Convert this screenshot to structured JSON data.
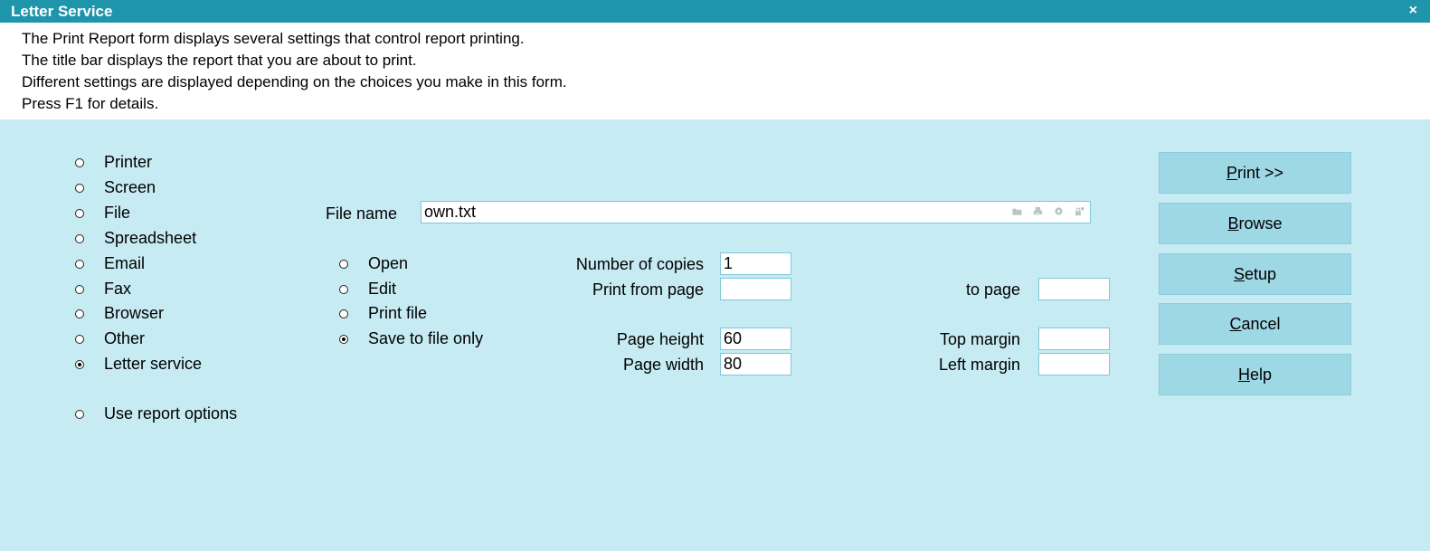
{
  "window": {
    "title": "Letter Service",
    "close_label": "×"
  },
  "info_lines": [
    "The Print Report form displays several settings that control report printing.",
    "The title bar displays the report that you are about to print.",
    "Different settings are displayed depending on the choices you make in this form.",
    "Press F1 for details."
  ],
  "destinations": [
    {
      "label": "Printer",
      "checked": false
    },
    {
      "label": "Screen",
      "checked": false
    },
    {
      "label": "File",
      "checked": false
    },
    {
      "label": "Spreadsheet",
      "checked": false
    },
    {
      "label": "Email",
      "checked": false
    },
    {
      "label": "Fax",
      "checked": false
    },
    {
      "label": "Browser",
      "checked": false
    },
    {
      "label": "Other",
      "checked": false
    },
    {
      "label": "Letter service",
      "checked": true
    }
  ],
  "use_report_options": {
    "label": "Use report options",
    "checked": false
  },
  "file_name": {
    "label": "File name",
    "value": "own.txt"
  },
  "file_actions": [
    {
      "label": "Open",
      "checked": false
    },
    {
      "label": "Edit",
      "checked": false
    },
    {
      "label": "Print file",
      "checked": false
    },
    {
      "label": "Save to file only",
      "checked": true
    }
  ],
  "settings": {
    "copies": {
      "label": "Number of copies",
      "value": "1"
    },
    "from_page": {
      "label": "Print from page",
      "value": ""
    },
    "to_page": {
      "label": "to page",
      "value": ""
    },
    "page_height": {
      "label": "Page height",
      "value": "60"
    },
    "top_margin": {
      "label": "Top margin",
      "value": ""
    },
    "page_width": {
      "label": "Page width",
      "value": "80"
    },
    "left_margin": {
      "label": "Left margin",
      "value": ""
    }
  },
  "buttons": {
    "print": {
      "accel": "P",
      "rest": "rint >>"
    },
    "browse": {
      "accel": "B",
      "rest": "rowse"
    },
    "setup": {
      "accel": "S",
      "rest": "etup"
    },
    "cancel": {
      "accel": "C",
      "rest": "ancel"
    },
    "help": {
      "accel": "H",
      "rest": "elp"
    }
  },
  "colors": {
    "titlebar": "#1f95ab",
    "background": "#c7ebf3",
    "button": "#9fd8e5"
  }
}
